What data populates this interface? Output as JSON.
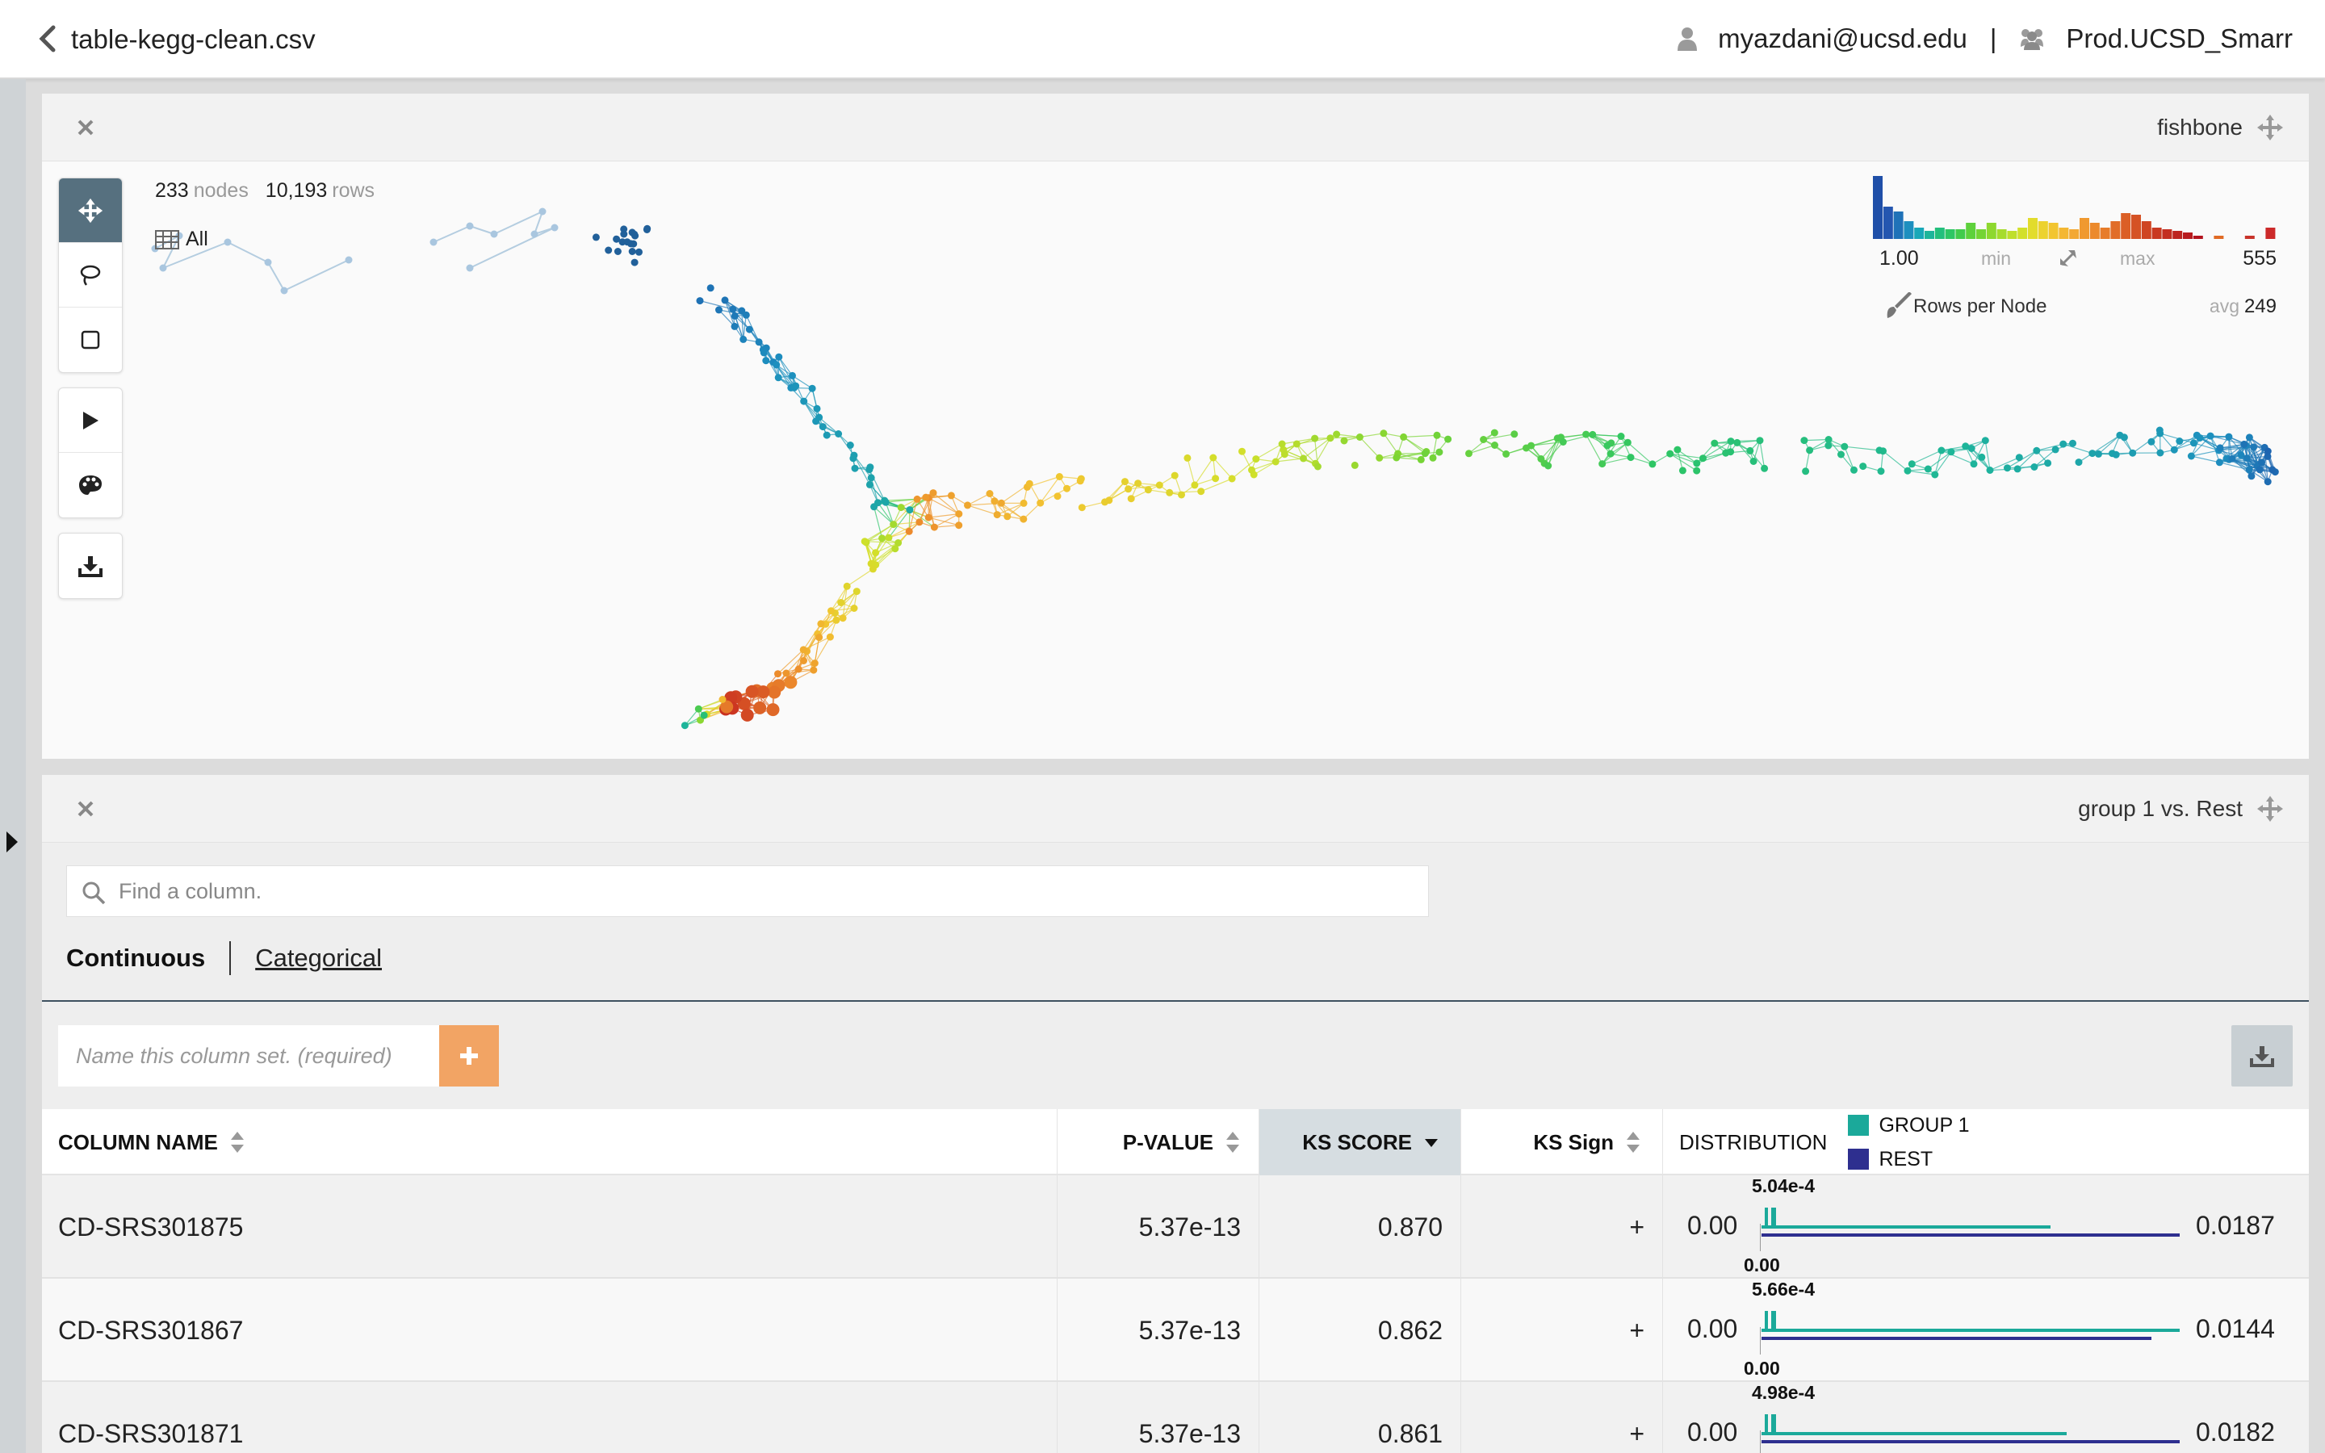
{
  "header": {
    "filename": "table-kegg-clean.csv",
    "user_email": "myazdani@ucsd.edu",
    "separator": "|",
    "org": "Prod.UCSD_Smarr"
  },
  "graph_panel": {
    "title": "fishbone",
    "node_count": "233",
    "node_unit": "nodes",
    "row_count": "10,193",
    "row_unit": "rows",
    "all_label": "All",
    "legend": {
      "min_value": "1.00",
      "min_label": "min",
      "max_label": "max",
      "max_value": "555",
      "metric_label": "Rows per Node",
      "avg_label": "avg",
      "avg_value": "249"
    }
  },
  "compare_panel": {
    "title": "group 1 vs. Rest",
    "search_placeholder": "Find a column.",
    "tab_continuous": "Continuous",
    "tab_categorical": "Categorical",
    "colset_placeholder": "Name this column set. (required)",
    "columns": {
      "name": "COLUMN NAME",
      "pvalue": "P-VALUE",
      "ks_score": "KS SCORE",
      "ks_sign": "KS Sign",
      "distribution": "DISTRIBUTION"
    },
    "legend": {
      "group1": "GROUP 1",
      "rest": "REST",
      "group1_color": "#1ba99a",
      "rest_color": "#2e2f8f"
    },
    "rows": [
      {
        "name": "CD-SRS301875",
        "pvalue": "5.37e-13",
        "ks_score": "0.870",
        "ks_sign": "+",
        "dist_min": "0.00",
        "dist_max": "0.0187",
        "dist_peak": "5.04e-4",
        "dist_zero": "0.00"
      },
      {
        "name": "CD-SRS301867",
        "pvalue": "5.37e-13",
        "ks_score": "0.862",
        "ks_sign": "+",
        "dist_min": "0.00",
        "dist_max": "0.0144",
        "dist_peak": "5.66e-4",
        "dist_zero": "0.00"
      },
      {
        "name": "CD-SRS301871",
        "pvalue": "5.37e-13",
        "ks_score": "0.861",
        "ks_sign": "+",
        "dist_min": "0.00",
        "dist_max": "0.0182",
        "dist_peak": "4.98e-4",
        "dist_zero": ""
      }
    ]
  }
}
